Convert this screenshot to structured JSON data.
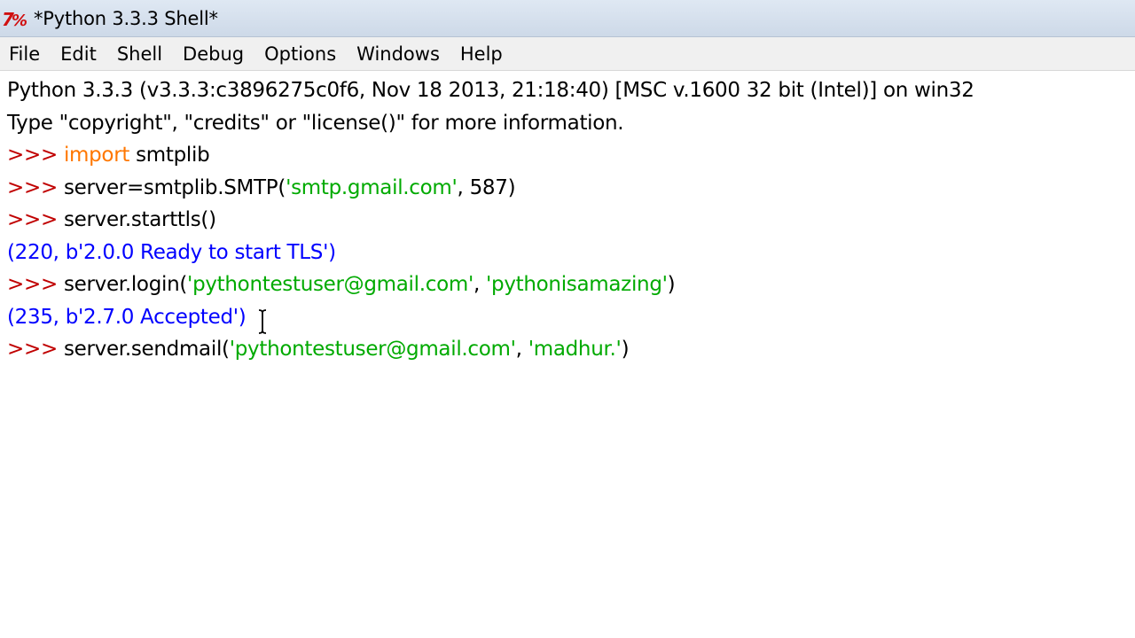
{
  "window": {
    "title": "*Python 3.3.3 Shell*",
    "icon": "idle-app-icon"
  },
  "menu": {
    "items": [
      "File",
      "Edit",
      "Shell",
      "Debug",
      "Options",
      "Windows",
      "Help"
    ]
  },
  "shell": {
    "banner_line_1": "Python 3.3.3 (v3.3.3:c3896275c0f6, Nov 18 2013, 21:18:40) [MSC v.1600 32 bit (Intel)] on win32",
    "banner_line_2": "Type \"copyright\", \"credits\" or \"license()\" for more information.",
    "prompt": ">>> ",
    "line_3": {
      "keyword": "import",
      "rest": " smtplib"
    },
    "line_4": {
      "code_before": "server=smtplib.SMTP(",
      "string": "'smtp.gmail.com'",
      "code_after": ", 587)"
    },
    "line_5": {
      "code": "server.starttls()"
    },
    "line_6": {
      "output": "(220, b'2.0.0 Ready to start TLS')"
    },
    "line_7": {
      "code_before": "server.login(",
      "string_1": "'pythontestuser@gmail.com'",
      "sep": ", ",
      "string_2": "'pythonisamazing'",
      "code_after": ")"
    },
    "line_8": {
      "output": "(235, b'2.7.0 Accepted')"
    },
    "line_9": {
      "code_before": "server.sendmail(",
      "string_1": "'pythontestuser@gmail.com'",
      "sep": ", ",
      "string_2": "'madhur.'",
      "code_after": ")"
    }
  },
  "colors": {
    "prompt": "#c00000",
    "keyword": "#ff7700",
    "string": "#00aa00",
    "output": "#0000ff",
    "titlebar": "#d6e1ef",
    "menubar": "#f0f0f0"
  }
}
